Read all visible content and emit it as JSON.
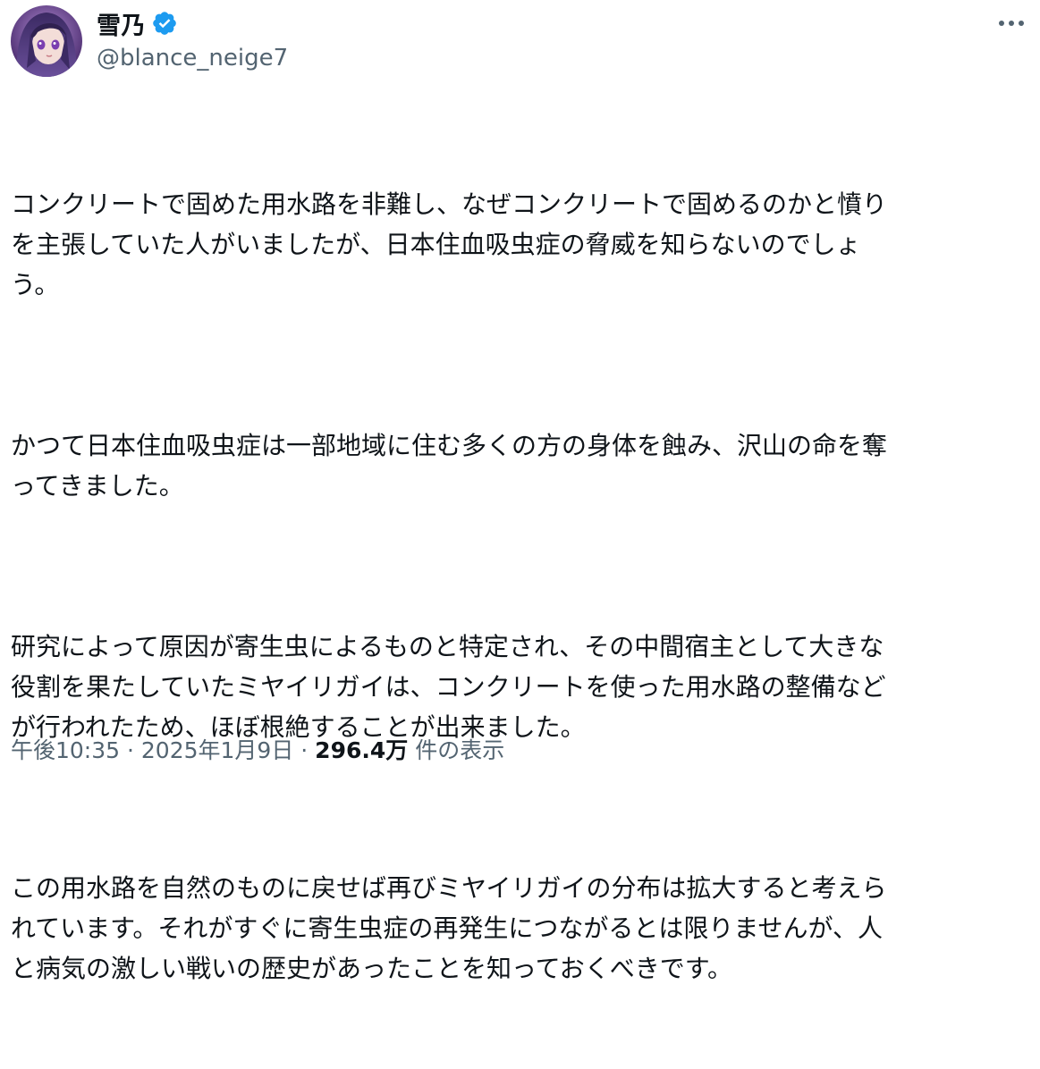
{
  "author": {
    "display_name": "雪乃",
    "handle": "@blance_neige7",
    "avatar_icon": "anime-character-avatar",
    "verified": true,
    "verified_color": "#1d9bf0"
  },
  "tweet": {
    "paragraphs": [
      "コンクリートで固めた用水路を非難し、なぜコンクリートで固めるのかと憤り\nを主張していた人がいましたが、日本住血吸虫症の脅威を知らないのでしょ\nう。",
      "かつて日本住血吸虫症は一部地域に住む多くの方の身体を蝕み、沢山の命を奪\nってきました。",
      "研究によって原因が寄生虫によるものと特定され、その中間宿主として大きな\n役割を果たしていたミヤイリガイは、コンクリートを使った用水路の整備など\nが行われたため、ほぼ根絶することが出来ました。",
      "この用水路を自然のものに戻せば再びミヤイリガイの分布は拡大すると考えら\nれています。それがすぐに寄生虫症の再発生につながるとは限りませんが、人\nと病気の激しい戦いの歴史があったことを知っておくべきです。"
    ]
  },
  "meta": {
    "time": "午後10:35",
    "separator": " · ",
    "date": "2025年1月9日",
    "views_count": "296.4万",
    "views_label": "件の表示"
  },
  "colors": {
    "text": "#0f1419",
    "secondary": "#536471",
    "verified": "#1d9bf0"
  },
  "icons": {
    "more": "more-horizontal-icon",
    "verified": "verified-badge-icon"
  }
}
